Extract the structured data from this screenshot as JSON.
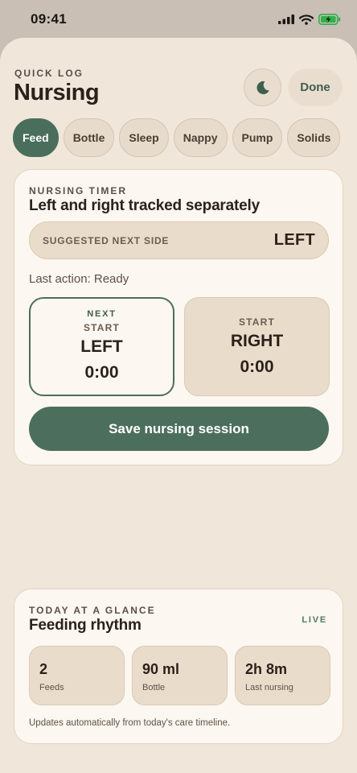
{
  "status_bar": {
    "time": "09:41"
  },
  "header": {
    "eyebrow": "QUICK LOG",
    "title": "Nursing",
    "theme_icon": "moon-icon",
    "done_label": "Done"
  },
  "tabs": [
    {
      "label": "Feed",
      "active": true
    },
    {
      "label": "Bottle",
      "active": false
    },
    {
      "label": "Sleep",
      "active": false
    },
    {
      "label": "Nappy",
      "active": false
    },
    {
      "label": "Pump",
      "active": false
    },
    {
      "label": "Solids",
      "active": false
    }
  ],
  "nursing_timer": {
    "eyebrow": "NURSING TIMER",
    "title": "Left and right tracked separately",
    "suggested_label": "SUGGESTED NEXT SIDE",
    "suggested_value": "LEFT",
    "last_action": "Last action: Ready",
    "left": {
      "badge": "NEXT",
      "action": "START",
      "side": "LEFT",
      "elapsed": "0:00"
    },
    "right": {
      "action": "START",
      "side": "RIGHT",
      "elapsed": "0:00"
    },
    "save_label": "Save nursing session"
  },
  "glance": {
    "eyebrow": "TODAY AT A GLANCE",
    "title": "Feeding rhythm",
    "live_label": "LIVE",
    "stats": [
      {
        "value": "2",
        "label": "Feeds"
      },
      {
        "value": "90 ml",
        "label": "Bottle"
      },
      {
        "value": "2h 8m",
        "label": "Last nursing"
      }
    ],
    "footnote": "Updates automatically from today's care timeline."
  },
  "colors": {
    "accent": "#4c6f5d",
    "background": "#f0e6da",
    "card": "#fcf7f0",
    "chip": "#eadccb"
  }
}
